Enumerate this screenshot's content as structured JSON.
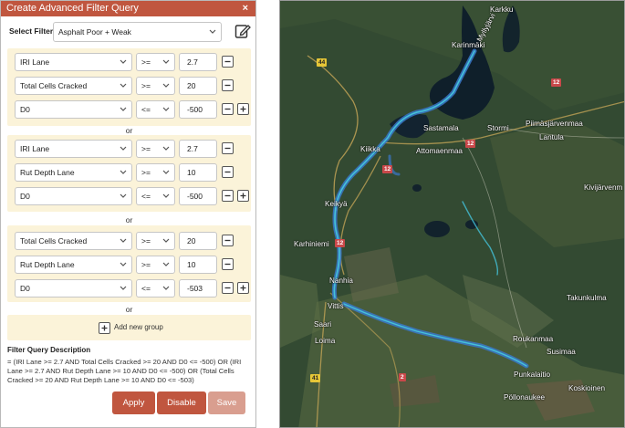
{
  "panel": {
    "title": "Create Advanced Filter Query",
    "close_label": "×",
    "select_filter_label": "Select Filter",
    "selected_filter": "Asphalt Poor + Weak"
  },
  "groups": [
    {
      "conditions": [
        {
          "field": "IRI Lane",
          "operator": ">=",
          "value": "2.7"
        },
        {
          "field": "Total Cells Cracked",
          "operator": ">=",
          "value": "20"
        },
        {
          "field": "D0",
          "operator": "<=",
          "value": "-500"
        }
      ]
    },
    {
      "conditions": [
        {
          "field": "IRI Lane",
          "operator": ">=",
          "value": "2.7"
        },
        {
          "field": "Rut Depth Lane",
          "operator": ">=",
          "value": "10"
        },
        {
          "field": "D0",
          "operator": "<=",
          "value": "-500"
        }
      ]
    },
    {
      "conditions": [
        {
          "field": "Total Cells Cracked",
          "operator": ">=",
          "value": "20"
        },
        {
          "field": "Rut Depth Lane",
          "operator": ">=",
          "value": "10"
        },
        {
          "field": "D0",
          "operator": "<=",
          "value": "-503"
        }
      ]
    }
  ],
  "or_label": "or",
  "add_group_label": "Add new group",
  "description": {
    "title": "Filter Query Description",
    "text": "= (IRI Lane >= 2.7 AND Total Cells Cracked >= 20 AND D0 <= -500) OR (IRI Lane >= 2.7 AND Rut Depth Lane >= 10 AND D0 <= -500) OR (Total Cells Cracked >= 20 AND Rut Depth Lane >= 10 AND D0 <= -503)"
  },
  "buttons": {
    "apply": "Apply",
    "disable": "Disable",
    "save": "Save"
  },
  "colors": {
    "accent": "#c0563f",
    "accent_disabled": "#d99e8f",
    "group_bg": "#fbf3d9",
    "route_highlight": "#3a78c9"
  },
  "map": {
    "places": [
      "Karkku",
      "Karinmäki",
      "Myllyjärvi",
      "Sastamala",
      "Stormi",
      "Piimäsjärvenmaa",
      "Lantula",
      "Kiikka",
      "Attomaenmaa",
      "Kivijärvenm",
      "Keikyä",
      "Karhiniemi",
      "Nanhia",
      "Takunkulma",
      "Vittis",
      "Saari",
      "Loima",
      "Roukanmaa",
      "Susimaa",
      "Punkalaitio",
      "Koskioinen",
      "Pöllonaukee"
    ],
    "road_shields": [
      "44",
      "12",
      "12",
      "12",
      "12",
      "41",
      "2"
    ]
  }
}
